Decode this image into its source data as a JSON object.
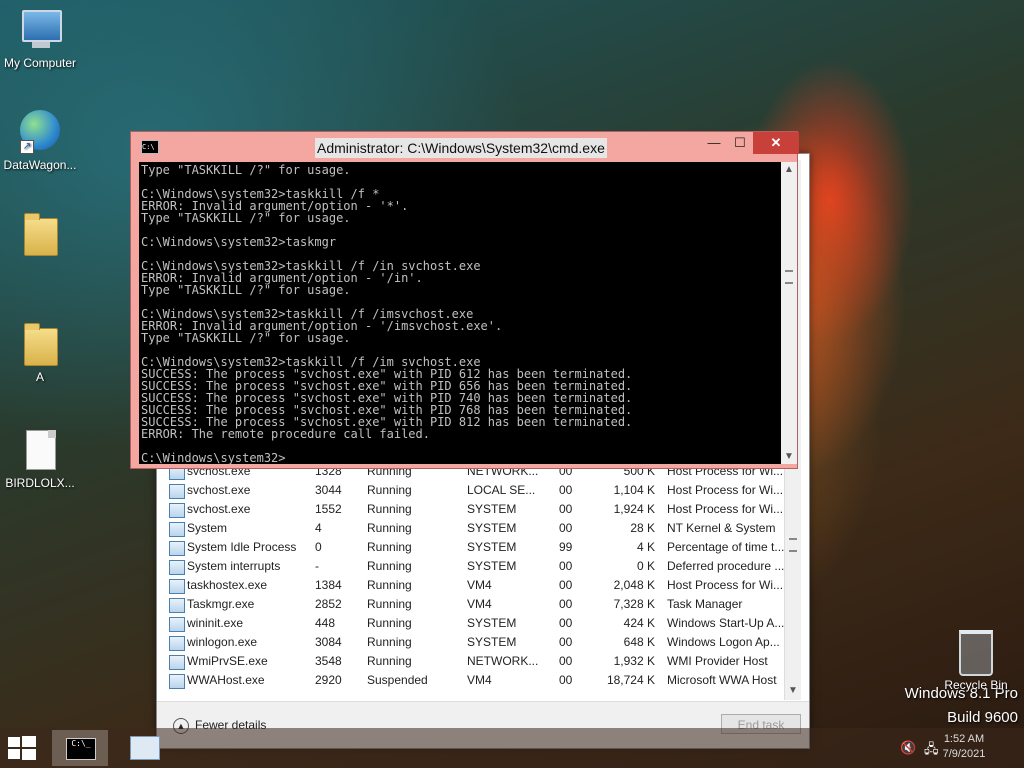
{
  "desktop": {
    "icons": [
      {
        "label": "My Computer",
        "icon": "computer-icon"
      },
      {
        "label": "DataWagon...",
        "icon": "globe-shortcut-icon"
      },
      {
        "label": "",
        "icon": "folder-icon"
      },
      {
        "label": "A",
        "icon": "folder-icon"
      },
      {
        "label": "BIRDLOLX...",
        "icon": "file-icon"
      }
    ],
    "recycle_bin": "Recycle Bin",
    "watermark": {
      "line1": "Windows 8.1 Pro",
      "line2": "Build 9600"
    }
  },
  "cmd": {
    "title": "Administrator: C:\\Windows\\System32\\cmd.exe",
    "minimize": "—",
    "maximize": "☐",
    "close": "✕",
    "console_text": "Type \"TASKKILL /?\" for usage.\n\nC:\\Windows\\system32>taskkill /f *\nERROR: Invalid argument/option - '*'.\nType \"TASKKILL /?\" for usage.\n\nC:\\Windows\\system32>taskmgr\n\nC:\\Windows\\system32>taskkill /f /in svchost.exe\nERROR: Invalid argument/option - '/in'.\nType \"TASKKILL /?\" for usage.\n\nC:\\Windows\\system32>taskkill /f /imsvchost.exe\nERROR: Invalid argument/option - '/imsvchost.exe'.\nType \"TASKKILL /?\" for usage.\n\nC:\\Windows\\system32>taskkill /f /im svchost.exe\nSUCCESS: The process \"svchost.exe\" with PID 612 has been terminated.\nSUCCESS: The process \"svchost.exe\" with PID 656 has been terminated.\nSUCCESS: The process \"svchost.exe\" with PID 740 has been terminated.\nSUCCESS: The process \"svchost.exe\" with PID 768 has been terminated.\nSUCCESS: The process \"svchost.exe\" with PID 812 has been terminated.\nERROR: The remote procedure call failed.\n\nC:\\Windows\\system32>"
  },
  "taskmgr": {
    "rows": [
      {
        "name": "svchost.exe",
        "pid": "1328",
        "status": "Running",
        "user": "NETWORK...",
        "cpu": "00",
        "mem": "500 K",
        "desc": "Host Process for Wi..."
      },
      {
        "name": "svchost.exe",
        "pid": "3044",
        "status": "Running",
        "user": "LOCAL SE...",
        "cpu": "00",
        "mem": "1,104 K",
        "desc": "Host Process for Wi..."
      },
      {
        "name": "svchost.exe",
        "pid": "1552",
        "status": "Running",
        "user": "SYSTEM",
        "cpu": "00",
        "mem": "1,924 K",
        "desc": "Host Process for Wi..."
      },
      {
        "name": "System",
        "pid": "4",
        "status": "Running",
        "user": "SYSTEM",
        "cpu": "00",
        "mem": "28 K",
        "desc": "NT Kernel & System"
      },
      {
        "name": "System Idle Process",
        "pid": "0",
        "status": "Running",
        "user": "SYSTEM",
        "cpu": "99",
        "mem": "4 K",
        "desc": "Percentage of time t..."
      },
      {
        "name": "System interrupts",
        "pid": "-",
        "status": "Running",
        "user": "SYSTEM",
        "cpu": "00",
        "mem": "0 K",
        "desc": "Deferred procedure ..."
      },
      {
        "name": "taskhostex.exe",
        "pid": "1384",
        "status": "Running",
        "user": "VM4",
        "cpu": "00",
        "mem": "2,048 K",
        "desc": "Host Process for Wi..."
      },
      {
        "name": "Taskmgr.exe",
        "pid": "2852",
        "status": "Running",
        "user": "VM4",
        "cpu": "00",
        "mem": "7,328 K",
        "desc": "Task Manager"
      },
      {
        "name": "wininit.exe",
        "pid": "448",
        "status": "Running",
        "user": "SYSTEM",
        "cpu": "00",
        "mem": "424 K",
        "desc": "Windows Start-Up A..."
      },
      {
        "name": "winlogon.exe",
        "pid": "3084",
        "status": "Running",
        "user": "SYSTEM",
        "cpu": "00",
        "mem": "648 K",
        "desc": "Windows Logon Ap..."
      },
      {
        "name": "WmiPrvSE.exe",
        "pid": "3548",
        "status": "Running",
        "user": "NETWORK...",
        "cpu": "00",
        "mem": "1,932 K",
        "desc": "WMI Provider Host"
      },
      {
        "name": "WWAHost.exe",
        "pid": "2920",
        "status": "Suspended",
        "user": "VM4",
        "cpu": "00",
        "mem": "18,724 K",
        "desc": "Microsoft WWA Host"
      }
    ],
    "fewer_details": "Fewer details",
    "end_task": "End task"
  },
  "taskbar": {
    "clock_time": "1:52 AM",
    "clock_date": "7/9/2021"
  }
}
